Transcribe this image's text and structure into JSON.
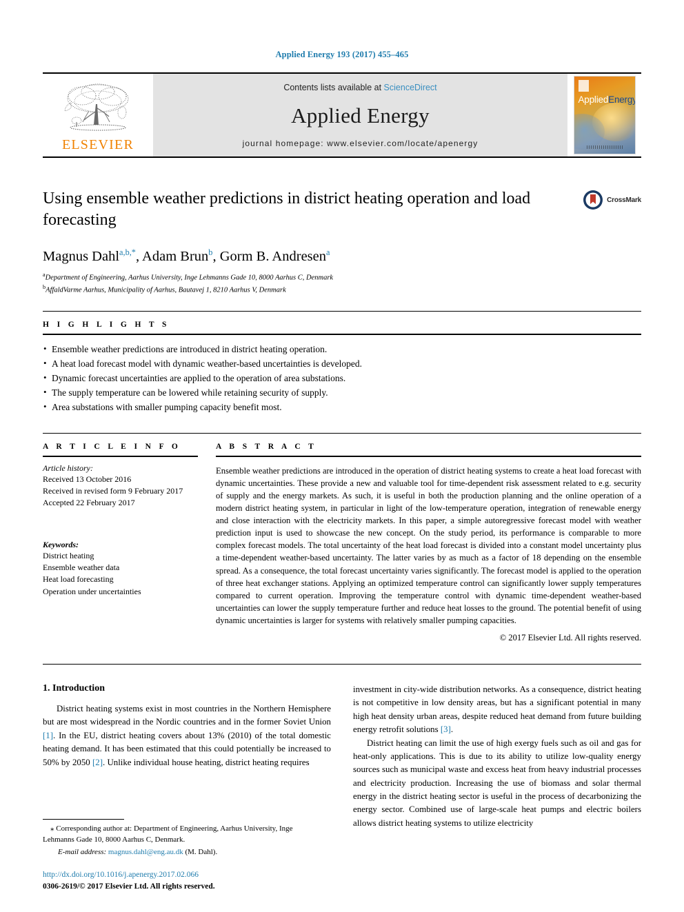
{
  "running_head": "Applied Energy 193 (2017) 455–465",
  "masthead": {
    "publisher_name": "ELSEVIER",
    "contents_prefix": "Contents lists available at",
    "contents_link": "ScienceDirect",
    "journal_name": "Applied Energy",
    "homepage_line": "journal homepage: www.elsevier.com/locate/apenergy",
    "cover_title_part1": "Applied",
    "cover_title_part2": "Energy"
  },
  "article": {
    "title": "Using ensemble weather predictions in district heating operation and load forecasting",
    "crossmark_label": "CrossMark",
    "authors_html": "Magnus Dahl<sup>a,b,*</sup>, Adam Brun<sup>b</sup>, Gorm B. Andresen<sup>a</sup>",
    "affiliation_a": "Department of Engineering, Aarhus University, Inge Lehmanns Gade 10, 8000 Aarhus C, Denmark",
    "affiliation_b": "AffaldVarme Aarhus, Municipality of Aarhus, Bautavej 1, 8210 Aarhus V, Denmark"
  },
  "highlights": {
    "heading": "H I G H L I G H T S",
    "items": [
      "Ensemble weather predictions are introduced in district heating operation.",
      "A heat load forecast model with dynamic weather-based uncertainties is developed.",
      "Dynamic forecast uncertainties are applied to the operation of area substations.",
      "The supply temperature can be lowered while retaining security of supply.",
      "Area substations with smaller pumping capacity benefit most."
    ]
  },
  "article_info": {
    "heading": "A R T I C L E   I N F O",
    "history_label": "Article history:",
    "history": [
      "Received 13 October 2016",
      "Received in revised form 9 February 2017",
      "Accepted 22 February 2017"
    ],
    "keywords_label": "Keywords:",
    "keywords": [
      "District heating",
      "Ensemble weather data",
      "Heat load forecasting",
      "Operation under uncertainties"
    ]
  },
  "abstract": {
    "heading": "A B S T R A C T",
    "text": "Ensemble weather predictions are introduced in the operation of district heating systems to create a heat load forecast with dynamic uncertainties. These provide a new and valuable tool for time-dependent risk assessment related to e.g. security of supply and the energy markets. As such, it is useful in both the production planning and the online operation of a modern district heating system, in particular in light of the low-temperature operation, integration of renewable energy and close interaction with the electricity markets. In this paper, a simple autoregressive forecast model with weather prediction input is used to showcase the new concept. On the study period, its performance is comparable to more complex forecast models. The total uncertainty of the heat load forecast is divided into a constant model uncertainty plus a time-dependent weather-based uncertainty. The latter varies by as much as a factor of 18 depending on the ensemble spread. As a consequence, the total forecast uncertainty varies significantly. The forecast model is applied to the operation of three heat exchanger stations. Applying an optimized temperature control can significantly lower supply temperatures compared to current operation. Improving the temperature control with dynamic time-dependent weather-based uncertainties can lower the supply temperature further and reduce heat losses to the ground. The potential benefit of using dynamic uncertainties is larger for systems with relatively smaller pumping capacities.",
    "copyright": "© 2017 Elsevier Ltd. All rights reserved."
  },
  "body": {
    "section_title": "1. Introduction",
    "left_paragraph_1_pre": "District heating systems exist in most countries in the Northern Hemisphere but are most widespread in the Nordic countries and in the former Soviet Union ",
    "ref1": "[1]",
    "left_paragraph_1_mid": ". In the EU, district heating covers about 13% (2010) of the total domestic heating demand. It has been estimated that this could potentially be increased to 50% by 2050 ",
    "ref2": "[2]",
    "left_paragraph_1_post": ". Unlike individual house heating, district heating requires",
    "right_paragraph_1_pre": "investment in city-wide distribution networks. As a consequence, district heating is not competitive in low density areas, but has a significant potential in many high heat density urban areas, despite reduced heat demand from future building energy retrofit solutions ",
    "ref3": "[3]",
    "right_paragraph_1_post": ".",
    "right_paragraph_2": "District heating can limit the use of high exergy fuels such as oil and gas for heat-only applications. This is due to its ability to utilize low-quality energy sources such as municipal waste and excess heat from heavy industrial processes and electricity production. Increasing the use of biomass and solar thermal energy in the district heating sector is useful in the process of decarbonizing the energy sector. Combined use of large-scale heat pumps and electric boilers allows district heating systems to utilize electricity"
  },
  "footer": {
    "corresponding_marker": "⁎",
    "corresponding_text": "Corresponding author at: Department of Engineering, Aarhus University, Inge Lehmanns Gade 10, 8000 Aarhus C, Denmark.",
    "email_label": "E-mail address:",
    "email_address": "magnus.dahl@eng.au.dk",
    "email_suffix": "(M. Dahl).",
    "doi": "http://dx.doi.org/10.1016/j.apenergy.2017.02.066",
    "issn_line": "0306-2619/© 2017 Elsevier Ltd. All rights reserved."
  },
  "colors": {
    "link_blue": "#1f7cad",
    "elsevier_orange": "#f08100",
    "masthead_gray": "#e3e3e3"
  }
}
